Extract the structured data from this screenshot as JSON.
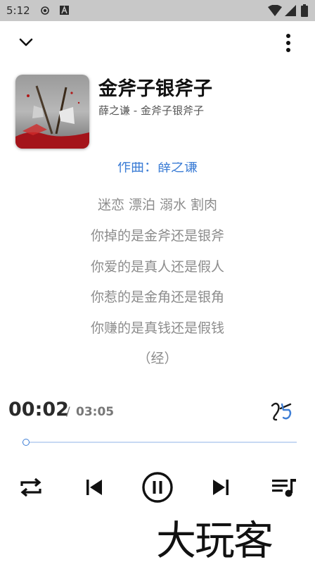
{
  "status_bar": {
    "time": "5:12",
    "icons": [
      "record-icon",
      "app-a-icon",
      "wifi-icon",
      "signal-icon",
      "battery-icon"
    ]
  },
  "header": {
    "collapse_icon": "chevron-down-icon",
    "more_icon": "more-vertical-icon"
  },
  "song": {
    "title": "金斧子银斧子",
    "subtitle": "薛之谦 - 金斧子银斧子"
  },
  "lyrics": {
    "partial_top": "作曲：薛之谦",
    "lines": [
      "迷恋 漂泊 溺水 割肉",
      "你掉的是金斧还是银斧",
      "你爱的是真人还是假人",
      "你惹的是金角还是银角",
      "你赚的是真钱还是假钱",
      "（经）"
    ]
  },
  "player": {
    "current_time": "00:02",
    "separator": "/",
    "total_time": "03:05",
    "progress_fraction": 0.011,
    "lyric_mode_icon": "lyric-mode-icon"
  },
  "controls": {
    "repeat_icon": "repeat-icon",
    "prev_icon": "skip-previous-icon",
    "play_pause_icon": "pause-icon",
    "next_icon": "skip-next-icon",
    "queue_icon": "playlist-icon"
  },
  "watermark": {
    "text": "大玩客"
  },
  "colors": {
    "accent": "#3f7fd6",
    "status_bar": "#c8c8c8",
    "lyric_inactive": "#8c8c8c"
  }
}
